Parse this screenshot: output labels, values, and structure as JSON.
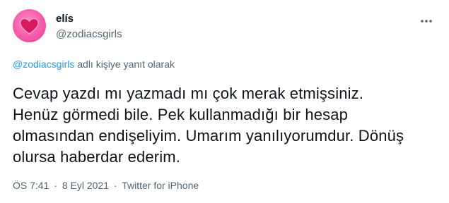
{
  "tweet": {
    "avatar_icon": "pink-heart-avatar",
    "author": {
      "display_name": "elís",
      "handle": "@zodiacsgirls"
    },
    "menu_icon": "more-horizontal-icon",
    "reply_context": {
      "mention": "@zodiacsgirls",
      "suffix": "adlı kişiye yanıt olarak"
    },
    "text_lines": [
      "Cevap yazdı mı yazmadı mı çok merak etmişsiniz.",
      "Henüz görmedi bile. Pek kullanmadığı bir hesap",
      "olmasından endişeliyim. Umarım yanılıyorumdur. Dönüş",
      "olursa haberdar ederim."
    ],
    "meta": {
      "time": "ÖS 7:41",
      "separator": "·",
      "date": "8 Eyl 2021",
      "source": "Twitter for iPhone"
    },
    "colors": {
      "text": "#0f1419",
      "secondary": "#536471",
      "link": "#1d9bf0",
      "avatar": "#f55aa8",
      "heart": "#d8195f"
    }
  }
}
